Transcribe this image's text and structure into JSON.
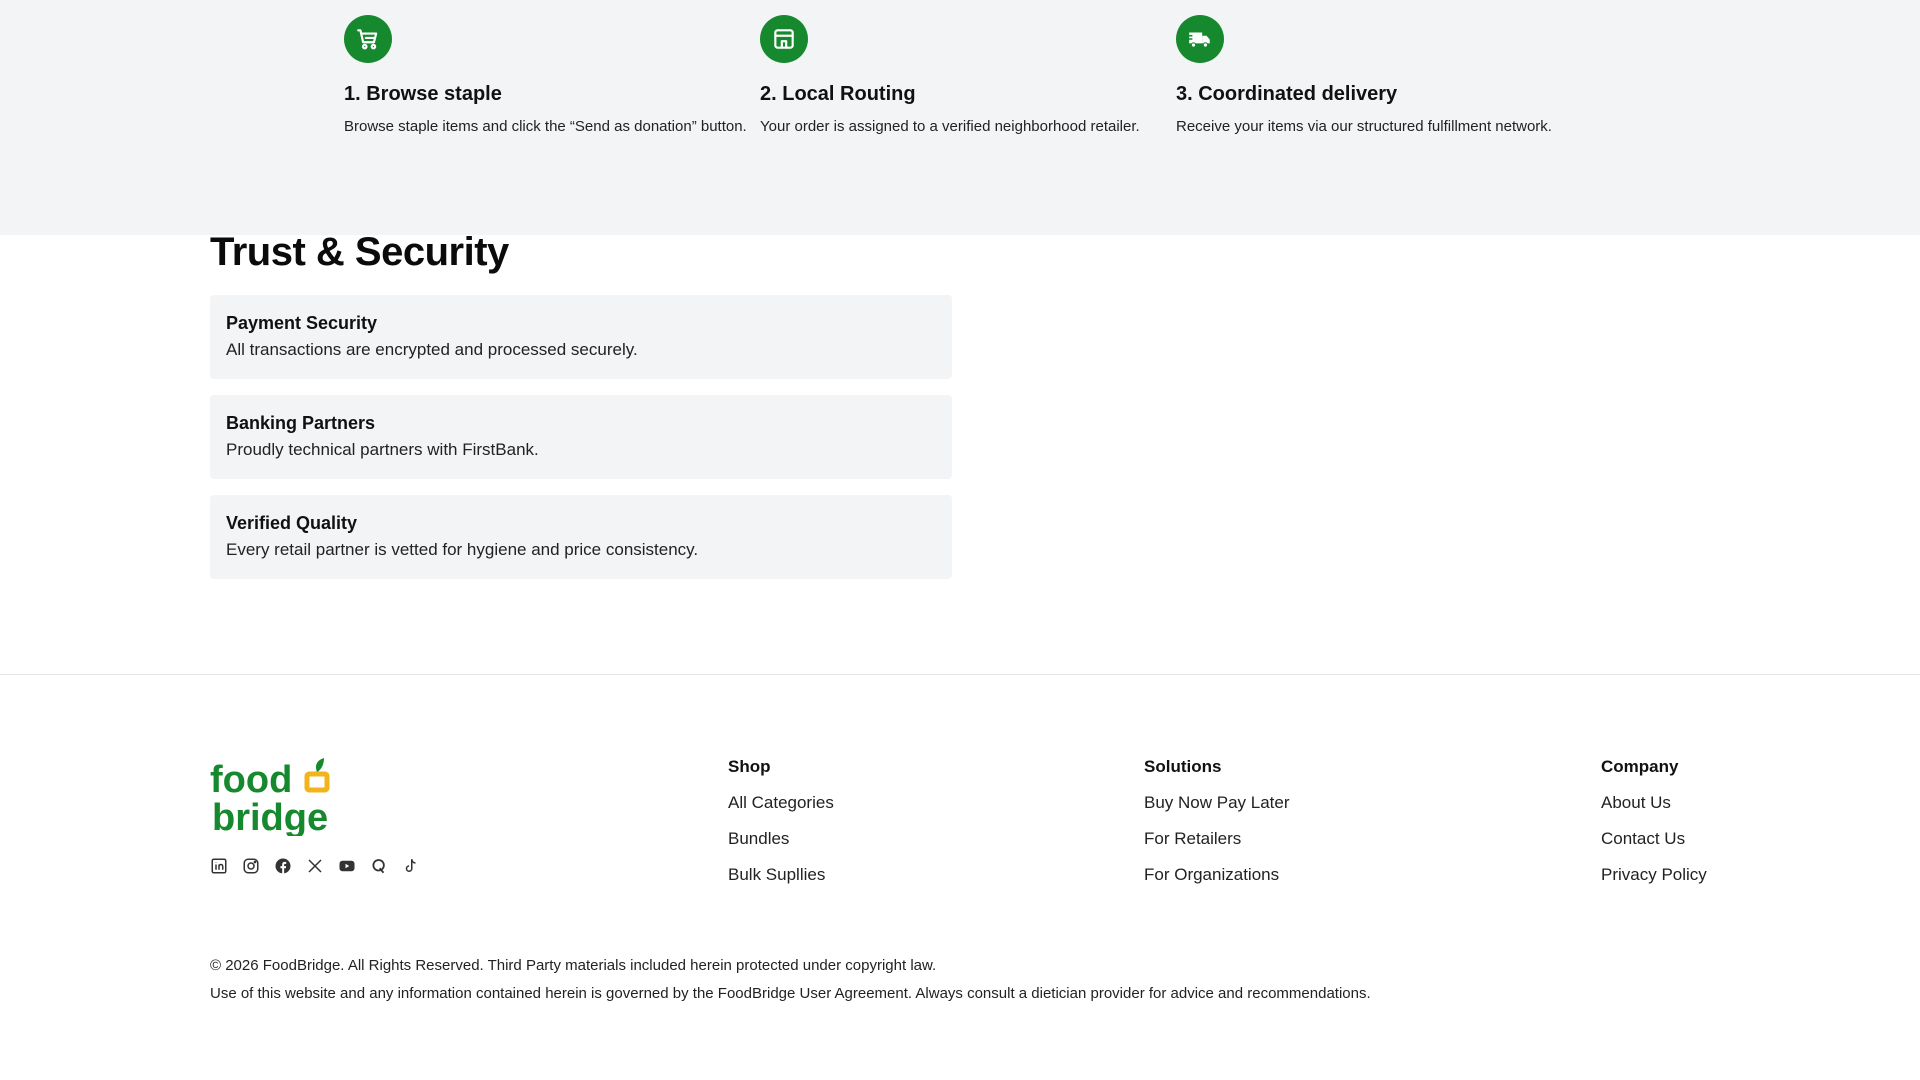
{
  "steps": [
    {
      "icon": "shopping-cart-icon",
      "title": "1. Browse staple",
      "desc": "Browse staple items and click the “Send as donation” button."
    },
    {
      "icon": "store-icon",
      "title": "2. Local Routing",
      "desc": "Your order is assigned to a verified neighborhood retailer."
    },
    {
      "icon": "delivery-truck-icon",
      "title": "3. Coordinated delivery",
      "desc": "Receive your items via our structured fulfillment network."
    }
  ],
  "trust": {
    "title": "Trust & Security",
    "cards": [
      {
        "title": "Payment Security",
        "desc": "All transactions are encrypted and processed securely."
      },
      {
        "title": "Banking Partners",
        "desc": "Proudly technical partners with FirstBank."
      },
      {
        "title": "Verified Quality",
        "desc": "Every retail partner is vetted for hygiene and price consistency."
      }
    ]
  },
  "footer": {
    "logo": {
      "line1": "food",
      "line2": "bridge"
    },
    "social": [
      "linkedin-icon",
      "instagram-icon",
      "facebook-icon",
      "x-icon",
      "youtube-icon",
      "quora-icon",
      "tiktok-icon"
    ],
    "columns": [
      {
        "title": "Shop",
        "links": [
          "All Categories",
          "Bundles",
          "Bulk Supllies"
        ]
      },
      {
        "title": "Solutions",
        "links": [
          "Buy Now Pay Later",
          "For Retailers",
          "For Organizations"
        ]
      },
      {
        "title": "Company",
        "links": [
          "About Us",
          "Contact Us",
          "Privacy Policy"
        ]
      }
    ],
    "copyright": "© 2026 FoodBridge. All Rights Reserved. Third Party materials included herein protected under copyright law.",
    "disclaimer": "Use of this website and any information contained herein is governed by the FoodBridge User Agreement. Always consult a dietician provider for advice and recommendations."
  },
  "colors": {
    "brand_green": "#16892f",
    "logo_orange": "#f2b31b",
    "band_bg": "#f3f4f6"
  }
}
